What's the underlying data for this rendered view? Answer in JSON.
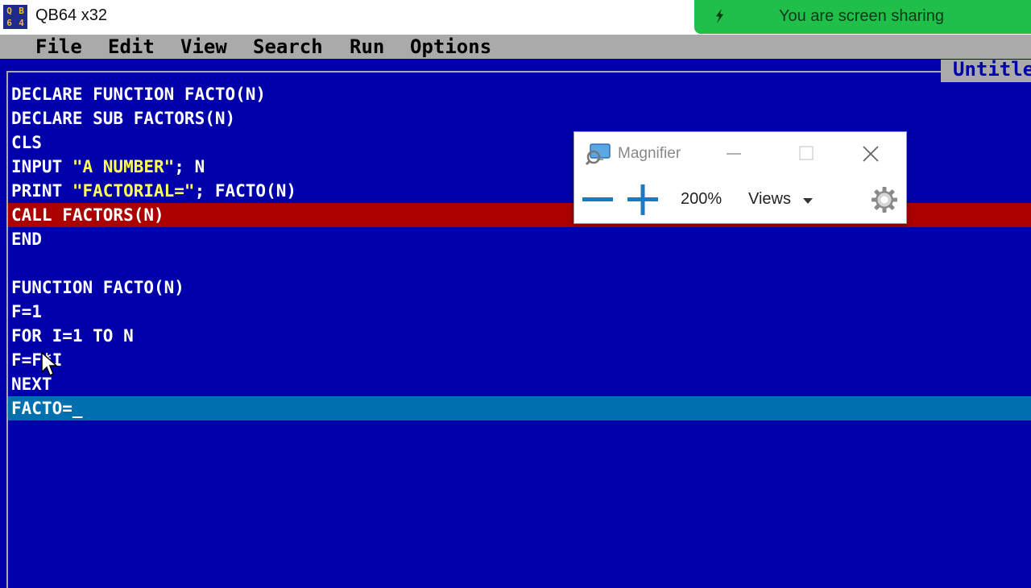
{
  "window": {
    "title": "QB64 x32",
    "icon_glyphs": [
      "Q",
      "B",
      "6",
      "4"
    ]
  },
  "share_banner": {
    "text": "You are screen sharing",
    "color": "#1fbf4a"
  },
  "menu": {
    "items": [
      "File",
      "Edit",
      "View",
      "Search",
      "Run",
      "Options"
    ]
  },
  "editor": {
    "file_label": "Untitled",
    "background": "#0000aa",
    "error_highlight_color": "#aa0000",
    "current_line_color": "#0070b0",
    "lines": [
      {
        "segments": [
          {
            "text": "DECLARE FUNCTION FACTO(N)",
            "type": "code"
          }
        ]
      },
      {
        "segments": [
          {
            "text": "DECLARE SUB FACTORS(N)",
            "type": "code"
          }
        ]
      },
      {
        "segments": [
          {
            "text": "CLS",
            "type": "code"
          }
        ]
      },
      {
        "segments": [
          {
            "text": "INPUT ",
            "type": "code"
          },
          {
            "text": "\"A NUMBER\"",
            "type": "str"
          },
          {
            "text": "; N",
            "type": "code"
          }
        ]
      },
      {
        "segments": [
          {
            "text": "PRINT ",
            "type": "code"
          },
          {
            "text": "\"FACTORIAL=\"",
            "type": "str"
          },
          {
            "text": "; FACTO(N)",
            "type": "code"
          }
        ]
      },
      {
        "segments": [
          {
            "text": "CALL FACTORS(N)",
            "type": "code"
          }
        ],
        "highlight": "error"
      },
      {
        "segments": [
          {
            "text": "END",
            "type": "code"
          }
        ]
      },
      {
        "segments": [
          {
            "text": "",
            "type": "code"
          }
        ]
      },
      {
        "segments": [
          {
            "text": "FUNCTION FACTO(N)",
            "type": "code"
          }
        ]
      },
      {
        "segments": [
          {
            "text": "F=1",
            "type": "code"
          }
        ]
      },
      {
        "segments": [
          {
            "text": "FOR I=1 TO N",
            "type": "code"
          }
        ]
      },
      {
        "segments": [
          {
            "text": "F=F*I",
            "type": "code"
          }
        ]
      },
      {
        "segments": [
          {
            "text": "NEXT",
            "type": "code"
          }
        ]
      },
      {
        "segments": [
          {
            "text": "FACTO=_",
            "type": "code"
          }
        ],
        "highlight": "current"
      }
    ]
  },
  "magnifier": {
    "title": "Magnifier",
    "zoom": "200%",
    "views_label": "Views",
    "accent": "#1a7ac4",
    "icons": [
      "magnifier-app-icon",
      "minimize-icon",
      "maximize-icon",
      "close-icon",
      "zoom-out-icon",
      "zoom-in-icon",
      "chevron-down-icon",
      "gear-icon"
    ]
  }
}
